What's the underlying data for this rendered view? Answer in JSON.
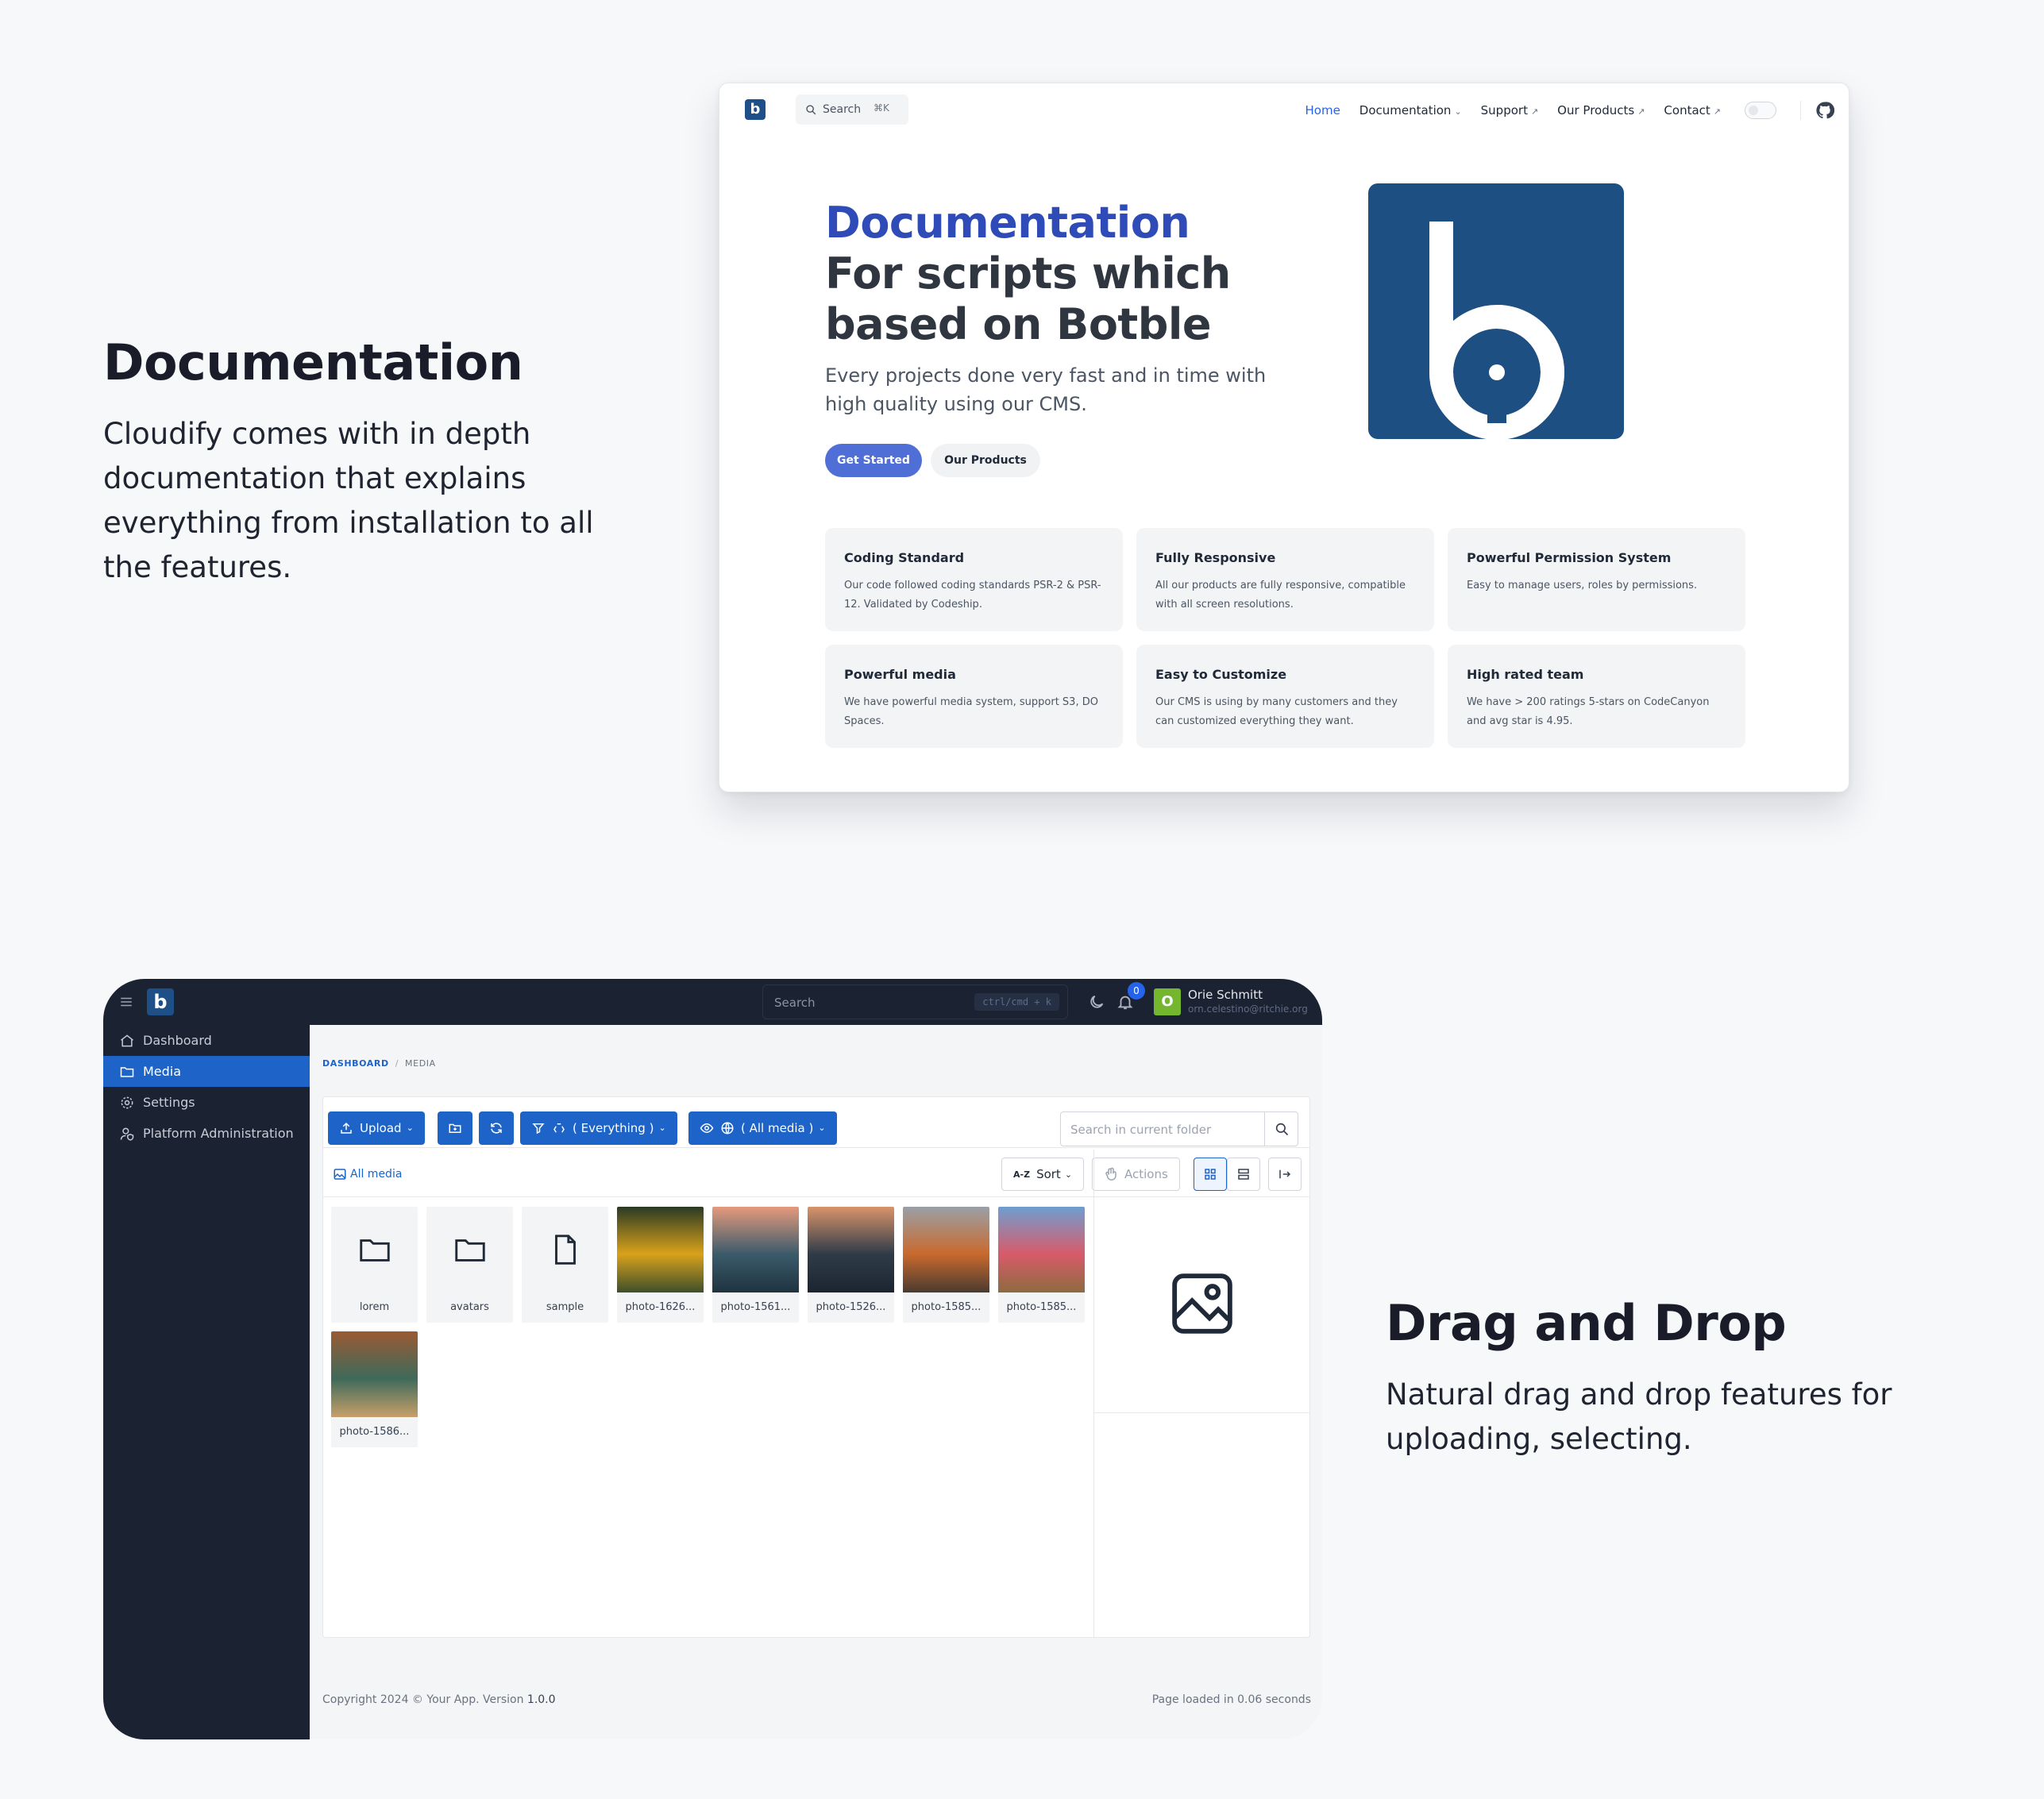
{
  "section1": {
    "title": "Documentation",
    "description": "Cloudify comes with in depth documentation that explains everything from installation to all the features."
  },
  "docs": {
    "logo_letter": "b",
    "search": {
      "label": "Search",
      "shortcut": "⌘K"
    },
    "menu": [
      {
        "label": "Home",
        "active": true,
        "suffix": ""
      },
      {
        "label": "Documentation",
        "suffix": "⌄"
      },
      {
        "label": "Support",
        "suffix": "↗"
      },
      {
        "label": "Our Products",
        "suffix": "↗"
      },
      {
        "label": "Contact",
        "suffix": "↗"
      }
    ],
    "hero": {
      "title_accent": "Documentation",
      "title_line2": "For scripts which",
      "title_line3": "based on Botble",
      "subtitle": "Every projects done very fast and in time with high quality using our CMS.",
      "primary_button": "Get Started",
      "secondary_button": "Our Products"
    },
    "features": [
      {
        "title": "Coding Standard",
        "desc": "Our code followed coding standards PSR-2 & PSR-12. Validated by Codeship."
      },
      {
        "title": "Fully Responsive",
        "desc": "All our products are fully responsive, compatible with all screen resolutions."
      },
      {
        "title": "Powerful Permission System",
        "desc": "Easy to manage users, roles by permissions."
      },
      {
        "title": "Powerful media",
        "desc": "We have powerful media system, support S3, DO Spaces."
      },
      {
        "title": "Easy to Customize",
        "desc": "Our CMS is using by many customers and they can customized everything they want."
      },
      {
        "title": "High rated team",
        "desc": "We have > 200 ratings 5-stars on CodeCanyon and avg star is 4.95."
      }
    ],
    "colors": {
      "accent": "#2f4bb8",
      "primary_button": "#4f6fd6",
      "logo_bg": "#1e4f82"
    }
  },
  "app": {
    "logo_letter": "b",
    "search": {
      "placeholder": "Search",
      "shortcut": "ctrl/cmd + k"
    },
    "notifications": "0",
    "user": {
      "initial": "O",
      "name": "Orie Schmitt",
      "email": "orn.celestino@ritchie.org"
    },
    "sidebar": [
      {
        "label": "Dashboard",
        "icon": "home-icon",
        "active": false
      },
      {
        "label": "Media",
        "icon": "folder-icon",
        "active": true
      },
      {
        "label": "Settings",
        "icon": "gear-icon",
        "active": false
      },
      {
        "label": "Platform Administration",
        "icon": "user-shield-icon",
        "active": false
      }
    ],
    "breadcrumb": {
      "first": "DASHBOARD",
      "separator": "/",
      "second": "MEDIA"
    },
    "toolbar": {
      "upload": "Upload",
      "filter": "( Everything )",
      "view": "( All media )",
      "folder_search_placeholder": "Search in current folder"
    },
    "subbar": {
      "all_media": "All media",
      "sort_prefix": "A-Z",
      "sort": "Sort",
      "actions": "Actions"
    },
    "items": [
      {
        "name": "lorem",
        "type": "folder"
      },
      {
        "name": "avatars",
        "type": "folder"
      },
      {
        "name": "sample",
        "type": "file"
      },
      {
        "name": "photo-1626...",
        "type": "photo",
        "palette": [
          "#2a3a24",
          "#d9a21b",
          "#3e4f2a"
        ]
      },
      {
        "name": "photo-1561...",
        "type": "photo",
        "palette": [
          "#e59a7c",
          "#3b5b6b",
          "#1f3340"
        ]
      },
      {
        "name": "photo-1526...",
        "type": "photo",
        "palette": [
          "#d9946a",
          "#2f3c48",
          "#1b2530"
        ]
      },
      {
        "name": "photo-1585...",
        "type": "photo",
        "palette": [
          "#9aa0a6",
          "#c96a2e",
          "#4a3b2f"
        ]
      },
      {
        "name": "photo-1585...",
        "type": "photo",
        "palette": [
          "#6f9ed0",
          "#d85b6a",
          "#8d6b3f"
        ]
      },
      {
        "name": "photo-1586...",
        "type": "photo",
        "palette": [
          "#9a5a34",
          "#3e6a5a",
          "#c7a06a"
        ]
      }
    ],
    "footer": {
      "left_prefix": "Copyright 2024 © Your App. Version ",
      "version": "1.0.0",
      "right": "Page loaded in 0.06 seconds"
    },
    "colors": {
      "primary": "#1d63c8",
      "topbar": "#1b2232",
      "avatar": "#74b72e"
    }
  },
  "section2": {
    "title": "Drag and Drop",
    "description": "Natural drag and drop features for uploading, selecting."
  }
}
